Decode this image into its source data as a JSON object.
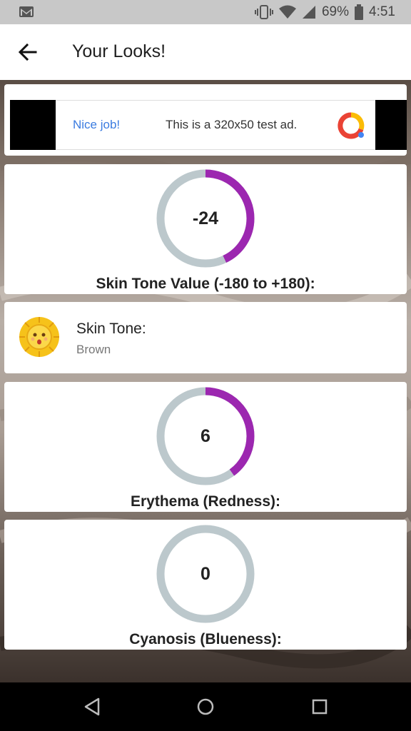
{
  "status_bar": {
    "battery_percent": "69%",
    "time": "4:51",
    "icons": [
      "gmail-icon",
      "vibrate-icon",
      "wifi-icon",
      "signal-icon",
      "battery-icon"
    ]
  },
  "app_bar": {
    "title": "Your Looks!",
    "back_icon": "arrow-left-icon"
  },
  "ad": {
    "headline": "Nice job!",
    "text": "This is a 320x50 test ad.",
    "logo_icon": "admob-icon"
  },
  "skin_tone_gauge": {
    "value": "-24",
    "fraction": 0.43,
    "label": "Skin Tone Value (-180 to +180):"
  },
  "skin_tone": {
    "title": "Skin Tone:",
    "value": "Brown",
    "icon": "sun-face-icon"
  },
  "erythema_gauge": {
    "value": "6",
    "fraction": 0.4,
    "label": "Erythema (Redness):"
  },
  "cyanosis_gauge": {
    "value": "0",
    "fraction": 0,
    "label": "Cyanosis (Blueness):"
  },
  "colors": {
    "gauge_track": "#bcc8cc",
    "gauge_fill": "#9c27b0",
    "ad_accent": "#3a7be0"
  },
  "nav_bar": {
    "buttons": [
      "back-triangle-icon",
      "home-circle-icon",
      "recents-square-icon"
    ]
  }
}
